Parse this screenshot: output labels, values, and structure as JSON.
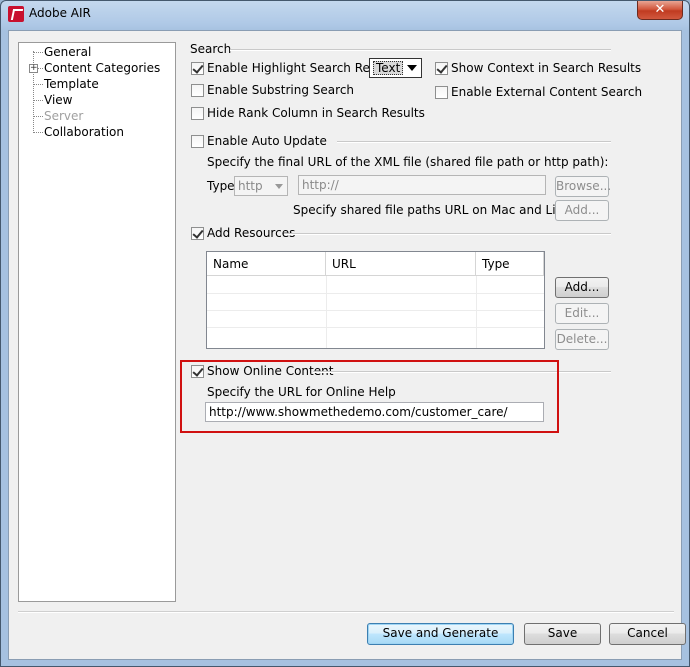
{
  "window": {
    "title": "Adobe AIR",
    "close_label": "✕"
  },
  "tree": {
    "items": [
      {
        "label": "General",
        "enabled": true
      },
      {
        "label": "Content Categories",
        "enabled": true,
        "expander": "+"
      },
      {
        "label": "Template",
        "enabled": true
      },
      {
        "label": "View",
        "enabled": true
      },
      {
        "label": "Server",
        "enabled": false
      },
      {
        "label": "Collaboration",
        "enabled": true
      }
    ]
  },
  "search": {
    "group_label": "Search",
    "highlight_label": "Enable Highlight Search Results",
    "highlight_checked": true,
    "highlight_mode": "Text",
    "context_label": "Show Context in Search Results",
    "context_checked": true,
    "substring_label": "Enable Substring Search",
    "substring_checked": false,
    "external_label": "Enable External Content Search",
    "external_checked": false,
    "hide_rank_label": "Hide Rank Column in Search Results",
    "hide_rank_checked": false
  },
  "auto_update": {
    "label": "Enable Auto Update",
    "checked": false,
    "url_prompt": "Specify the final URL of the XML file (shared file path or http path):",
    "type_label": "Type:",
    "type_value": "http",
    "url_value": "http://",
    "browse_label": "Browse...",
    "mac_prompt": "Specify shared file paths URL on Mac and Linux also:",
    "add_label": "Add..."
  },
  "resources": {
    "label": "Add Resources",
    "checked": true,
    "columns": [
      "Name",
      "URL",
      "Type"
    ],
    "add_label": "Add...",
    "edit_label": "Edit...",
    "delete_label": "Delete..."
  },
  "online": {
    "label": "Show Online Content",
    "checked": true,
    "help_prompt": "Specify the URL for Online Help",
    "help_url": "http://www.showmethedemo.com/customer_care/"
  },
  "footer": {
    "save_generate_label": "Save and Generate",
    "save_label": "Save",
    "cancel_label": "Cancel"
  },
  "colors": {
    "highlight_border": "#d01010",
    "default_button": "#3c7fb1"
  }
}
